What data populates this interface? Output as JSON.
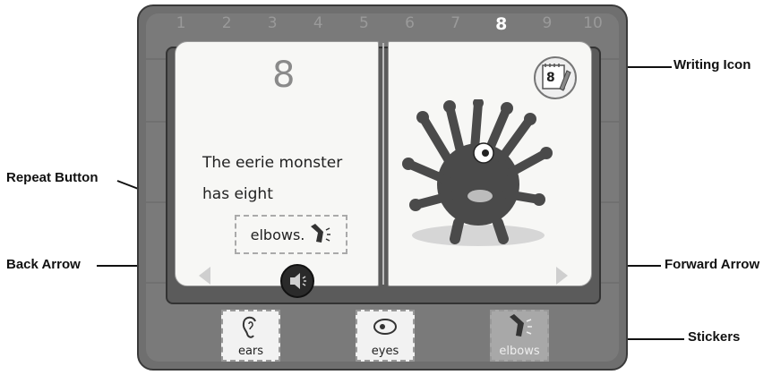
{
  "book_frame": {
    "numbers": [
      "1",
      "2",
      "3",
      "4",
      "5",
      "6",
      "7",
      "8",
      "9",
      "10"
    ],
    "active_number": "8"
  },
  "left_page": {
    "page_number": "8",
    "line1": "The eerie monster",
    "line2": "has eight",
    "target_word": "elbows."
  },
  "right_page": {
    "writing_number": "8",
    "illustration": "monster-illustration"
  },
  "stickers": [
    {
      "label": "ears",
      "icon": "ear-icon"
    },
    {
      "label": "eyes",
      "icon": "eye-icon"
    },
    {
      "label": "elbows",
      "icon": "elbow-icon",
      "selected": true
    }
  ],
  "callouts": {
    "writing_icon": "Writing Icon",
    "repeat_button": "Repeat Button",
    "back_arrow": "Back Arrow",
    "forward_arrow": "Forward Arrow",
    "stickers": "Stickers"
  },
  "colors": {
    "frame": "#6f6f6f",
    "page": "#f7f7f5",
    "active_number": "#ffffff"
  }
}
